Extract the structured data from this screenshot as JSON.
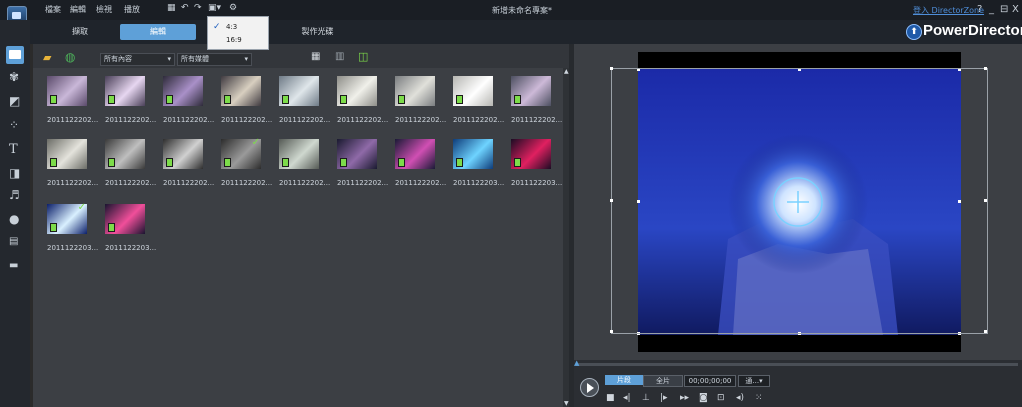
{
  "menu": [
    "檔案",
    "編輯",
    "檢視",
    "播放"
  ],
  "document_title": "新增未命名專案*",
  "login_link": "登入 DirectorZone",
  "window_controls": {
    "help": "?",
    "minimize": "_",
    "restore": "⊟",
    "close": "X"
  },
  "mode_tabs": {
    "capture": "擷取",
    "edit": "編輯",
    "produce": "製作光碟"
  },
  "brand": "PowerDirector",
  "aspect_menu": {
    "options": [
      "4:3",
      "16:9"
    ],
    "selected": "4:3"
  },
  "library_filters": {
    "content": "所有內容",
    "media": "所有媒體"
  },
  "clips_row1": [
    "2011122202...",
    "2011122202...",
    "2011122202...",
    "2011122202...",
    "2011122202...",
    "2011122202...",
    "2011122202...",
    "2011122202...",
    "2011122202..."
  ],
  "clips_row2": [
    "2011122202...",
    "2011122202...",
    "2011122202...",
    "2011122202...",
    "2011122202...",
    "2011122202...",
    "2011122202...",
    "2011122203...",
    "2011122203..."
  ],
  "clips_row3": [
    "2011122203...",
    "2011122203..."
  ],
  "preview_controls": {
    "clip": "片段",
    "movie": "全片",
    "timecode": "00;00;00;00",
    "quality": "通..."
  },
  "colors": {
    "accent": "#5ea0d8",
    "badge": "#7ddc4a",
    "link": "#4f8ed8"
  }
}
